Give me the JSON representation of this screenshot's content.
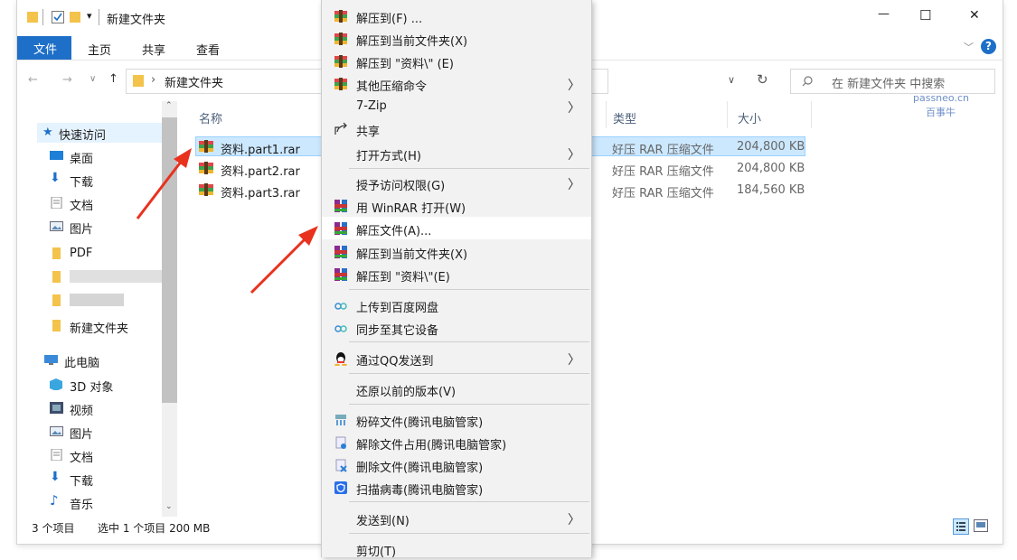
{
  "window": {
    "title": "新建文件夹",
    "quick_access_toolbar_arrow": "▾",
    "minimize": "—",
    "maximize": "☐",
    "close": "✕"
  },
  "ribbon": {
    "tabs": [
      "文件",
      "主页",
      "共享",
      "查看"
    ],
    "expand": "﹀",
    "help": "?"
  },
  "address": {
    "path": "新建文件夹",
    "search_placeholder": "在 新建文件夹 中搜索"
  },
  "watermark": {
    "line1": "passneo.cn",
    "line2": "百事牛"
  },
  "nav": {
    "quick_access": "快速访问",
    "items": [
      {
        "label": "桌面",
        "pinned": true,
        "icon": "desktop-icon"
      },
      {
        "label": "下载",
        "pinned": true,
        "icon": "download-icon"
      },
      {
        "label": "文档",
        "pinned": true,
        "icon": "document-icon"
      },
      {
        "label": "图片",
        "pinned": true,
        "icon": "picture-icon"
      },
      {
        "label": "PDF",
        "pinned": false,
        "icon": "folder-icon"
      },
      {
        "label": "新建文件夹",
        "pinned": false,
        "icon": "folder-icon"
      }
    ],
    "this_pc": "此电脑",
    "pc_items": [
      {
        "label": "3D 对象",
        "icon": "3d-objects-icon"
      },
      {
        "label": "视频",
        "icon": "video-icon"
      },
      {
        "label": "图片",
        "icon": "picture-icon"
      },
      {
        "label": "文档",
        "icon": "document-icon"
      },
      {
        "label": "下载",
        "icon": "download-icon"
      },
      {
        "label": "音乐",
        "icon": "music-icon"
      }
    ]
  },
  "columns": {
    "name": "名称",
    "type": "类型",
    "size": "大小"
  },
  "files": [
    {
      "name": "资料.part1.rar",
      "type": "好压 RAR 压缩文件",
      "size": "204,800 KB",
      "selected": true
    },
    {
      "name": "资料.part2.rar",
      "type": "好压 RAR 压缩文件",
      "size": "204,800 KB",
      "selected": false
    },
    {
      "name": "资料.part3.rar",
      "type": "好压 RAR 压缩文件",
      "size": "184,560 KB",
      "selected": false
    }
  ],
  "status": {
    "count": "3 个项目",
    "selection": "选中 1 个项目  200 MB"
  },
  "context_menu": {
    "items": [
      {
        "label": "解压到(F) ...",
        "icon": "haozip-icon",
        "submenu": false
      },
      {
        "label": "解压到当前文件夹(X)",
        "icon": "haozip-icon",
        "submenu": false
      },
      {
        "label": "解压到 \"资料\\\" (E)",
        "icon": "haozip-icon",
        "submenu": false
      },
      {
        "label": "其他压缩命令",
        "icon": "haozip-icon",
        "submenu": true
      },
      {
        "label": "7-Zip",
        "icon": "",
        "submenu": true
      },
      {
        "label": "共享",
        "icon": "share-icon",
        "submenu": false
      },
      {
        "label": "打开方式(H)",
        "icon": "",
        "submenu": true
      },
      {
        "label": "授予访问权限(G)",
        "icon": "",
        "submenu": true
      },
      {
        "label": "用 WinRAR 打开(W)",
        "icon": "winrar-icon",
        "submenu": false
      },
      {
        "label": "解压文件(A)...",
        "icon": "winrar-icon",
        "submenu": false,
        "highlighted": true
      },
      {
        "label": "解压到当前文件夹(X)",
        "icon": "winrar-icon",
        "submenu": false
      },
      {
        "label": "解压到 \"资料\\\"(E)",
        "icon": "winrar-icon",
        "submenu": false
      },
      {
        "label": "上传到百度网盘",
        "icon": "baidu-netdisk-icon",
        "submenu": false
      },
      {
        "label": "同步至其它设备",
        "icon": "baidu-netdisk-icon",
        "submenu": false
      },
      {
        "label": "通过QQ发送到",
        "icon": "qq-icon",
        "submenu": true
      },
      {
        "label": "还原以前的版本(V)",
        "icon": "",
        "submenu": false
      },
      {
        "label": "粉碎文件(腾讯电脑管家)",
        "icon": "shred-icon",
        "submenu": false
      },
      {
        "label": "解除文件占用(腾讯电脑管家)",
        "icon": "unlock-icon",
        "submenu": false
      },
      {
        "label": "删除文件(腾讯电脑管家)",
        "icon": "delete-icon",
        "submenu": false
      },
      {
        "label": "扫描病毒(腾讯电脑管家)",
        "icon": "shield-icon",
        "submenu": false
      },
      {
        "label": "发送到(N)",
        "icon": "",
        "submenu": true
      },
      {
        "label": "剪切(T)",
        "icon": "",
        "submenu": false
      }
    ],
    "submenu_arrow": "〉"
  },
  "colors": {
    "accent": "#1e6fc8",
    "selection_bg": "#cce8ff",
    "annotation_arrow": "#e8321e"
  }
}
